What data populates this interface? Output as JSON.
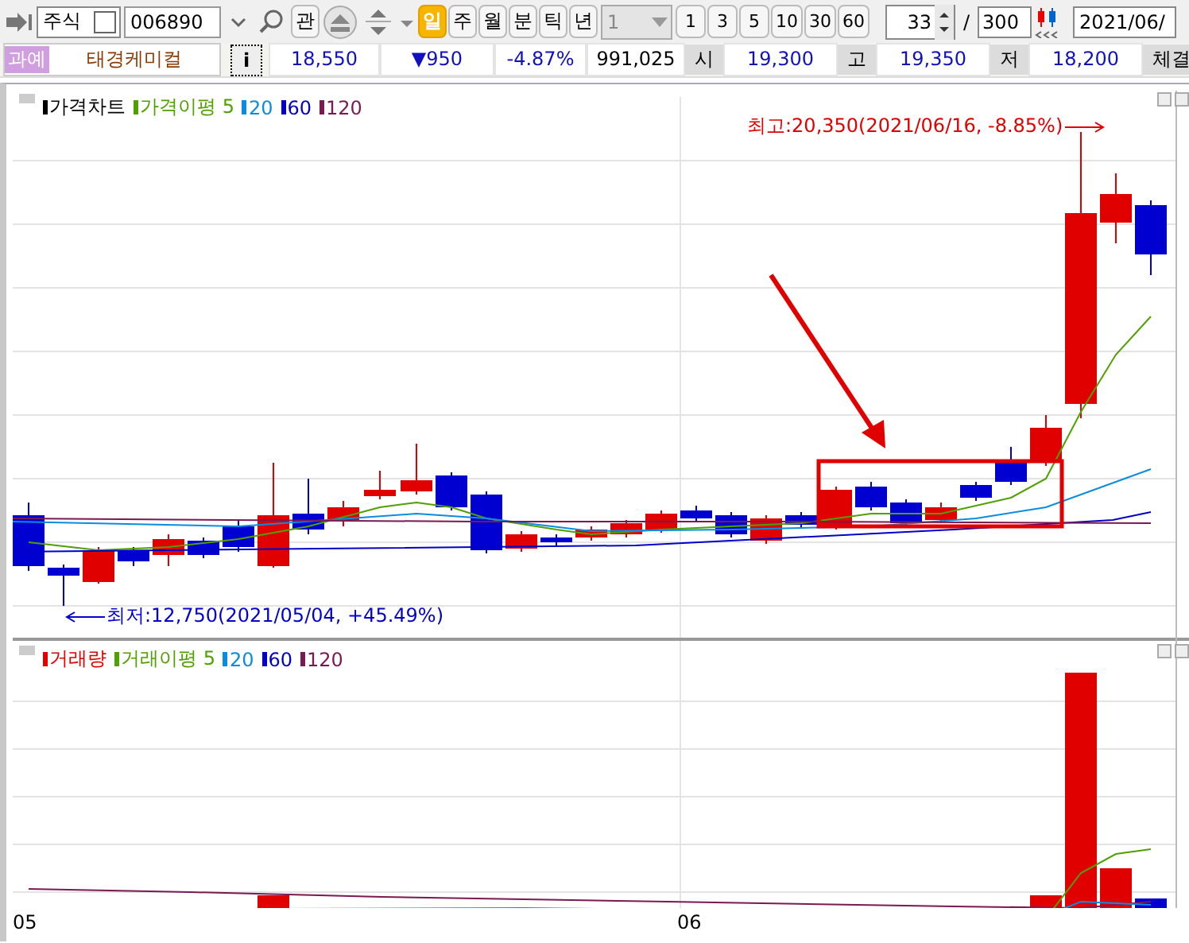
{
  "toolbar": {
    "market": "주식",
    "code": "006890",
    "watch_button": "관",
    "periods": [
      {
        "label": "일",
        "selected": true
      },
      {
        "label": "주",
        "selected": false
      },
      {
        "label": "월",
        "selected": false
      },
      {
        "label": "분",
        "selected": false
      },
      {
        "label": "틱",
        "selected": false
      },
      {
        "label": "년",
        "selected": false
      }
    ],
    "interval": "1",
    "intervals": [
      "1",
      "3",
      "5",
      "10",
      "30",
      "60"
    ],
    "count": "33",
    "separator": "/",
    "total": "300",
    "date": "2021/06/"
  },
  "quote": {
    "badge": "과예",
    "name": "태경케미컬",
    "info_button": "i",
    "price": "18,550",
    "change": "▼950",
    "rate": "-4.87%",
    "volume": "991,025",
    "fields": [
      {
        "label": "시",
        "value": "19,300"
      },
      {
        "label": "고",
        "value": "19,350"
      },
      {
        "label": "저",
        "value": "18,200"
      }
    ],
    "trailing": "체결"
  },
  "price_panel": {
    "legend": [
      {
        "label": "가격차트",
        "color": "#000000"
      },
      {
        "label": "가격이평 5",
        "color": "#4fa000"
      },
      {
        "label": "20",
        "color": "#0a8ce0"
      },
      {
        "label": "60",
        "color": "#0000c8"
      },
      {
        "label": "120",
        "color": "#7a1a50"
      }
    ],
    "high_note": "최고:20,350(2021/06/16, -8.85%)",
    "low_note": "최저:12,750(2021/05/04, +45.49%)"
  },
  "volume_panel": {
    "legend": [
      {
        "label": "거래량",
        "color": "#e00000"
      },
      {
        "label": "거래이평 5",
        "color": "#4fa000"
      },
      {
        "label": "20",
        "color": "#0a8ce0"
      },
      {
        "label": "60",
        "color": "#0000c8"
      },
      {
        "label": "120",
        "color": "#7a1a50"
      }
    ]
  },
  "x_axis": [
    "05",
    "06"
  ]
}
